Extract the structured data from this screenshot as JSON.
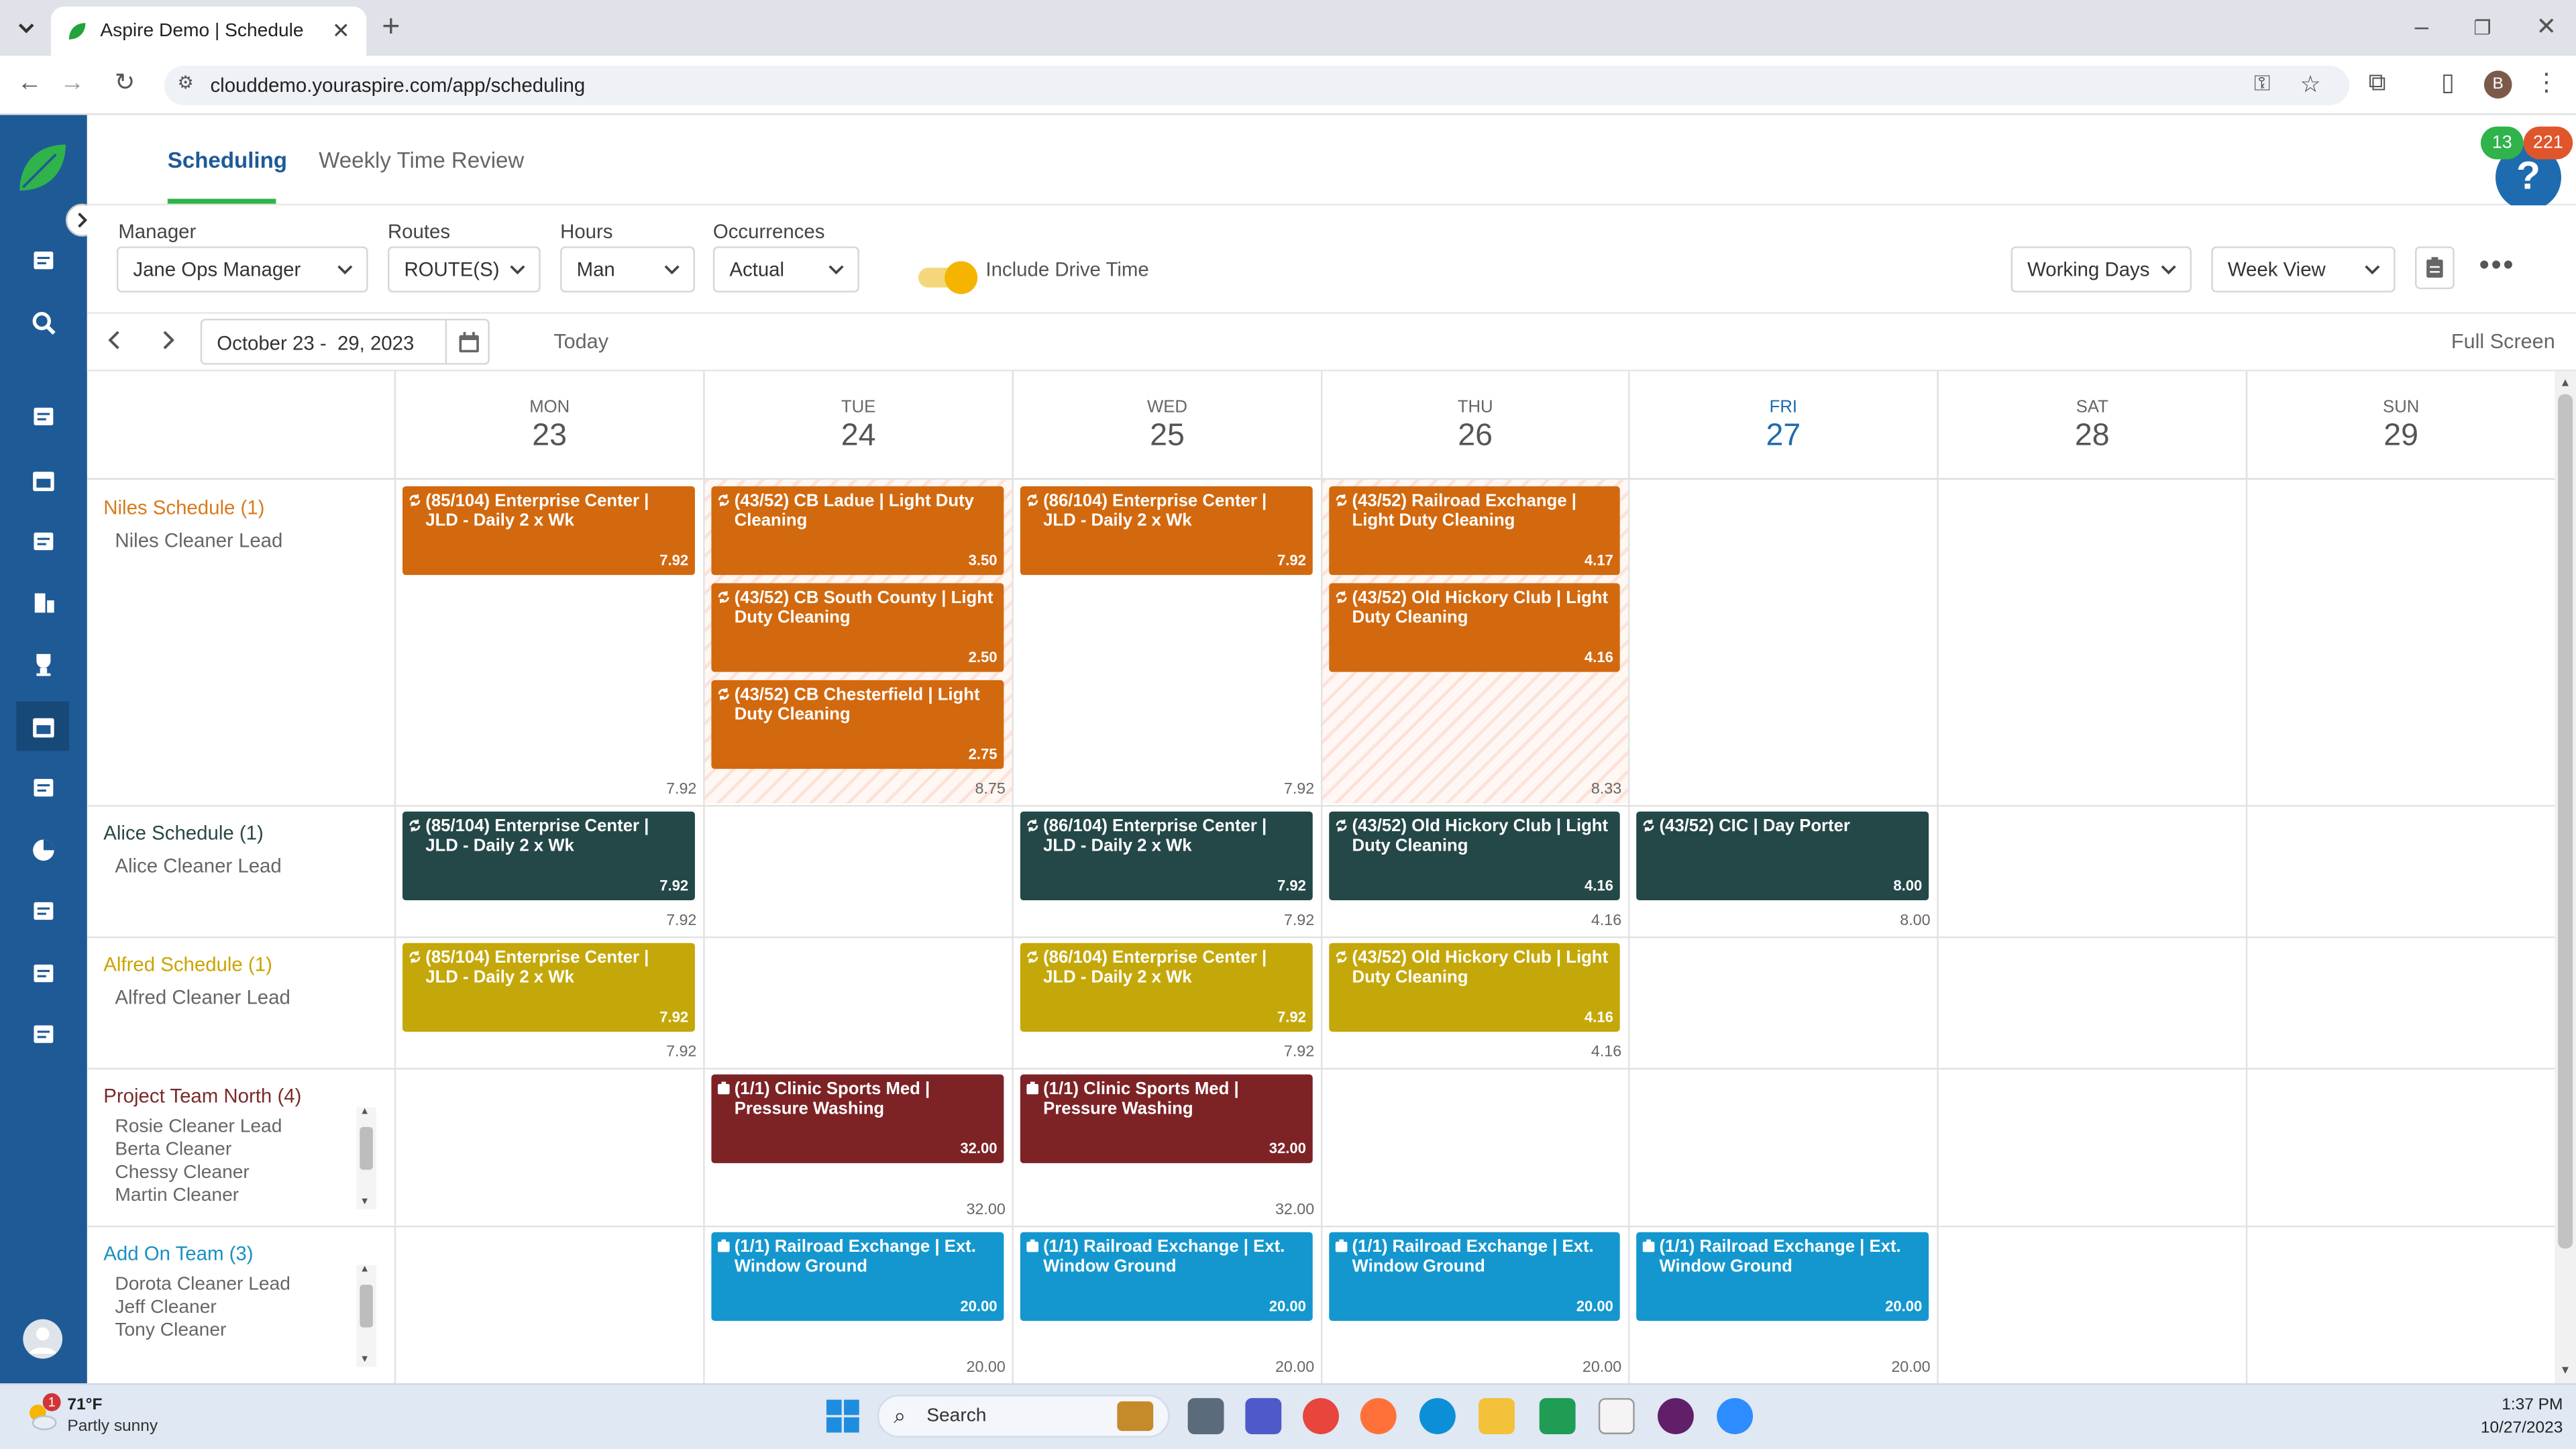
{
  "browser": {
    "tab_title": "Aspire Demo | Schedule",
    "url": "clouddemo.youraspire.com/app/scheduling",
    "profile_initial": "B"
  },
  "header": {
    "tabs": [
      "Scheduling",
      "Weekly Time Review"
    ],
    "active_tab": "Scheduling",
    "badge_green": "13",
    "badge_red": "221",
    "help_icon": "?"
  },
  "filters": {
    "manager_label": "Manager",
    "manager_value": "Jane Ops Manager",
    "routes_label": "Routes",
    "routes_value": "ROUTE(S)",
    "hours_label": "Hours",
    "hours_value": "Man",
    "occurrences_label": "Occurrences",
    "occurrences_value": "Actual",
    "drive_time_label": "Include Drive Time",
    "drive_time_on": true,
    "working_days": "Working Days",
    "view": "Week View"
  },
  "nav": {
    "date_range": "October 23 -  29, 2023",
    "today": "Today",
    "full_screen": "Full Screen"
  },
  "days": [
    {
      "name": "MON",
      "num": "23",
      "today": false
    },
    {
      "name": "TUE",
      "num": "24",
      "today": false
    },
    {
      "name": "WED",
      "num": "25",
      "today": false
    },
    {
      "name": "THU",
      "num": "26",
      "today": false
    },
    {
      "name": "FRI",
      "num": "27",
      "today": true
    },
    {
      "name": "SAT",
      "num": "28",
      "today": false
    },
    {
      "name": "SUN",
      "num": "29",
      "today": false
    }
  ],
  "groups": [
    {
      "title": "Niles Schedule (1)",
      "members": [
        "Niles Cleaner Lead"
      ],
      "color": "#d9771f"
    },
    {
      "title": "Alice Schedule (1)",
      "members": [
        "Alice Cleaner Lead"
      ],
      "color": "#2f4f4f"
    },
    {
      "title": "Alfred Schedule (1)",
      "members": [
        "Alfred Cleaner Lead"
      ],
      "color": "#c9a80c"
    },
    {
      "title": "Project Team North (4)",
      "members": [
        "Rosie Cleaner Lead",
        "Berta Cleaner",
        "Chessy Cleaner",
        "Martin Cleaner"
      ],
      "color": "#7a2a2a"
    },
    {
      "title": "Add On Team (3)",
      "members": [
        "Dorota Cleaner Lead",
        "Jeff Cleaner",
        "Tony Cleaner"
      ],
      "color": "#1a8fc2"
    }
  ],
  "cards": [
    {
      "row": 0,
      "day": 0,
      "slot": 0,
      "text": "(85/104) Enterprise Center | JLD - Daily 2 x Wk",
      "hours": "7.92",
      "color": "#d2690f"
    },
    {
      "row": 0,
      "day": 1,
      "slot": 0,
      "text": "(43/52) CB Ladue | Light Duty Cleaning",
      "hours": "3.50",
      "color": "#d2690f"
    },
    {
      "row": 0,
      "day": 1,
      "slot": 1,
      "text": "(43/52) CB South County | Light Duty Cleaning",
      "hours": "2.50",
      "color": "#d2690f"
    },
    {
      "row": 0,
      "day": 1,
      "slot": 2,
      "text": "(43/52) CB Chesterfield | Light Duty Cleaning",
      "hours": "2.75",
      "color": "#d2690f"
    },
    {
      "row": 0,
      "day": 2,
      "slot": 0,
      "text": "(86/104) Enterprise Center | JLD - Daily 2 x Wk",
      "hours": "7.92",
      "color": "#d2690f"
    },
    {
      "row": 0,
      "day": 3,
      "slot": 0,
      "text": "(43/52) Railroad Exchange | Light Duty Cleaning",
      "hours": "4.17",
      "color": "#d2690f"
    },
    {
      "row": 0,
      "day": 3,
      "slot": 1,
      "text": "(43/52) Old Hickory Club | Light Duty Cleaning",
      "hours": "4.16",
      "color": "#d2690f"
    },
    {
      "row": 1,
      "day": 0,
      "slot": 0,
      "text": "(85/104) Enterprise Center | JLD - Daily 2 x Wk",
      "hours": "7.92",
      "color": "#244747"
    },
    {
      "row": 1,
      "day": 2,
      "slot": 0,
      "text": "(86/104) Enterprise Center | JLD - Daily 2 x Wk",
      "hours": "7.92",
      "color": "#244747"
    },
    {
      "row": 1,
      "day": 3,
      "slot": 0,
      "text": "(43/52) Old Hickory Club | Light Duty Cleaning",
      "hours": "4.16",
      "color": "#244747"
    },
    {
      "row": 1,
      "day": 4,
      "slot": 0,
      "text": "(43/52) CIC | Day Porter",
      "hours": "8.00",
      "color": "#244747"
    },
    {
      "row": 2,
      "day": 0,
      "slot": 0,
      "text": "(85/104) Enterprise Center | JLD - Daily 2 x Wk",
      "hours": "7.92",
      "color": "#c4a80a"
    },
    {
      "row": 2,
      "day": 2,
      "slot": 0,
      "text": "(86/104) Enterprise Center | JLD - Daily 2 x Wk",
      "hours": "7.92",
      "color": "#c4a80a"
    },
    {
      "row": 2,
      "day": 3,
      "slot": 0,
      "text": "(43/52) Old Hickory Club | Light Duty Cleaning",
      "hours": "4.16",
      "color": "#c4a80a"
    },
    {
      "row": 3,
      "day": 1,
      "slot": 0,
      "text": "(1/1) Clinic Sports Med | Pressure Washing",
      "hours": "32.00",
      "color": "#7d2326"
    },
    {
      "row": 3,
      "day": 2,
      "slot": 0,
      "text": "(1/1) Clinic Sports Med | Pressure Washing",
      "hours": "32.00",
      "color": "#7d2326"
    },
    {
      "row": 4,
      "day": 1,
      "slot": 0,
      "text": "(1/1) Railroad Exchange | Ext. Window Ground",
      "hours": "20.00",
      "color": "#1497cf"
    },
    {
      "row": 4,
      "day": 2,
      "slot": 0,
      "text": "(1/1) Railroad Exchange | Ext. Window Ground",
      "hours": "20.00",
      "color": "#1497cf"
    },
    {
      "row": 4,
      "day": 3,
      "slot": 0,
      "text": "(1/1) Railroad Exchange | Ext. Window Ground",
      "hours": "20.00",
      "color": "#1497cf"
    },
    {
      "row": 4,
      "day": 4,
      "slot": 0,
      "text": "(1/1) Railroad Exchange | Ext. Window Ground",
      "hours": "20.00",
      "color": "#1497cf"
    }
  ],
  "totals": [
    {
      "row": 0,
      "day": 0,
      "value": "7.92"
    },
    {
      "row": 0,
      "day": 1,
      "value": "8.75"
    },
    {
      "row": 0,
      "day": 2,
      "value": "7.92"
    },
    {
      "row": 0,
      "day": 3,
      "value": "8.33"
    },
    {
      "row": 1,
      "day": 0,
      "value": "7.92"
    },
    {
      "row": 1,
      "day": 2,
      "value": "7.92"
    },
    {
      "row": 1,
      "day": 3,
      "value": "4.16"
    },
    {
      "row": 1,
      "day": 4,
      "value": "8.00"
    },
    {
      "row": 2,
      "day": 0,
      "value": "7.92"
    },
    {
      "row": 2,
      "day": 2,
      "value": "7.92"
    },
    {
      "row": 2,
      "day": 3,
      "value": "4.16"
    },
    {
      "row": 3,
      "day": 1,
      "value": "32.00"
    },
    {
      "row": 3,
      "day": 2,
      "value": "32.00"
    },
    {
      "row": 4,
      "day": 1,
      "value": "20.00"
    },
    {
      "row": 4,
      "day": 2,
      "value": "20.00"
    },
    {
      "row": 4,
      "day": 3,
      "value": "20.00"
    },
    {
      "row": 4,
      "day": 4,
      "value": "20.00"
    }
  ],
  "taskbar": {
    "weather_temp": "71°F",
    "weather_desc": "Partly sunny",
    "weather_badge": "1",
    "search_placeholder": "Search",
    "time": "1:37 PM",
    "date": "10/27/2023"
  },
  "sidebar_icons": [
    "camera-icon",
    "search-icon",
    "estimate-icon",
    "calendar-icon",
    "contact-card-icon",
    "building-icon",
    "trophy-icon",
    "schedule-icon",
    "clipboard-icon",
    "pie-chart-icon",
    "invoice-icon",
    "inventory-icon",
    "settings-group-icon"
  ]
}
